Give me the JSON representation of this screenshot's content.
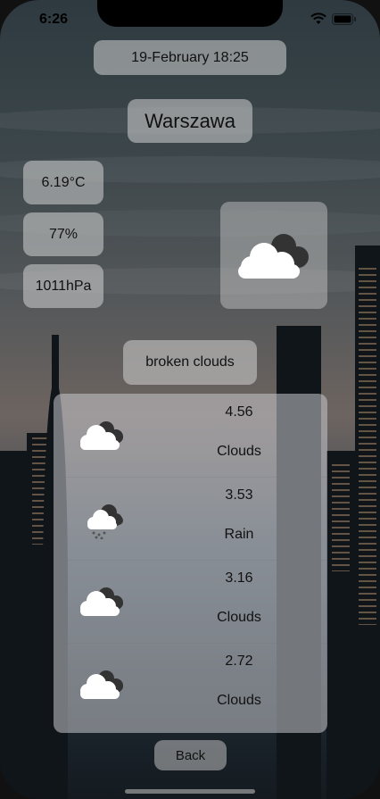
{
  "status_bar": {
    "time": "6:26"
  },
  "header": {
    "date": "19-February 18:25",
    "city": "Warszawa"
  },
  "current": {
    "temperature": "6.19°C",
    "humidity": "77%",
    "pressure": "1011hPa",
    "icon": "broken-clouds-icon",
    "description": "broken clouds"
  },
  "forecast": [
    {
      "value": "4.56",
      "main": "Clouds",
      "icon": "clouds-icon"
    },
    {
      "value": "3.53",
      "main": "Rain",
      "icon": "rain-icon"
    },
    {
      "value": "3.16",
      "main": "Clouds",
      "icon": "clouds-icon"
    },
    {
      "value": "2.72",
      "main": "Clouds",
      "icon": "clouds-icon"
    }
  ],
  "back_label": "Back"
}
